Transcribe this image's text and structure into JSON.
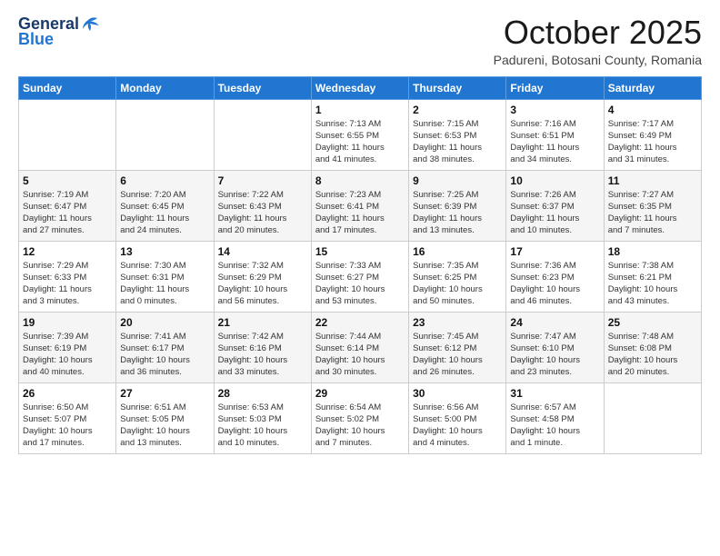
{
  "header": {
    "logo_line1": "General",
    "logo_line2": "Blue",
    "month": "October 2025",
    "location": "Padureni, Botosani County, Romania"
  },
  "weekdays": [
    "Sunday",
    "Monday",
    "Tuesday",
    "Wednesday",
    "Thursday",
    "Friday",
    "Saturday"
  ],
  "weeks": [
    [
      {
        "day": "",
        "info": ""
      },
      {
        "day": "",
        "info": ""
      },
      {
        "day": "",
        "info": ""
      },
      {
        "day": "1",
        "info": "Sunrise: 7:13 AM\nSunset: 6:55 PM\nDaylight: 11 hours\nand 41 minutes."
      },
      {
        "day": "2",
        "info": "Sunrise: 7:15 AM\nSunset: 6:53 PM\nDaylight: 11 hours\nand 38 minutes."
      },
      {
        "day": "3",
        "info": "Sunrise: 7:16 AM\nSunset: 6:51 PM\nDaylight: 11 hours\nand 34 minutes."
      },
      {
        "day": "4",
        "info": "Sunrise: 7:17 AM\nSunset: 6:49 PM\nDaylight: 11 hours\nand 31 minutes."
      }
    ],
    [
      {
        "day": "5",
        "info": "Sunrise: 7:19 AM\nSunset: 6:47 PM\nDaylight: 11 hours\nand 27 minutes."
      },
      {
        "day": "6",
        "info": "Sunrise: 7:20 AM\nSunset: 6:45 PM\nDaylight: 11 hours\nand 24 minutes."
      },
      {
        "day": "7",
        "info": "Sunrise: 7:22 AM\nSunset: 6:43 PM\nDaylight: 11 hours\nand 20 minutes."
      },
      {
        "day": "8",
        "info": "Sunrise: 7:23 AM\nSunset: 6:41 PM\nDaylight: 11 hours\nand 17 minutes."
      },
      {
        "day": "9",
        "info": "Sunrise: 7:25 AM\nSunset: 6:39 PM\nDaylight: 11 hours\nand 13 minutes."
      },
      {
        "day": "10",
        "info": "Sunrise: 7:26 AM\nSunset: 6:37 PM\nDaylight: 11 hours\nand 10 minutes."
      },
      {
        "day": "11",
        "info": "Sunrise: 7:27 AM\nSunset: 6:35 PM\nDaylight: 11 hours\nand 7 minutes."
      }
    ],
    [
      {
        "day": "12",
        "info": "Sunrise: 7:29 AM\nSunset: 6:33 PM\nDaylight: 11 hours\nand 3 minutes."
      },
      {
        "day": "13",
        "info": "Sunrise: 7:30 AM\nSunset: 6:31 PM\nDaylight: 11 hours\nand 0 minutes."
      },
      {
        "day": "14",
        "info": "Sunrise: 7:32 AM\nSunset: 6:29 PM\nDaylight: 10 hours\nand 56 minutes."
      },
      {
        "day": "15",
        "info": "Sunrise: 7:33 AM\nSunset: 6:27 PM\nDaylight: 10 hours\nand 53 minutes."
      },
      {
        "day": "16",
        "info": "Sunrise: 7:35 AM\nSunset: 6:25 PM\nDaylight: 10 hours\nand 50 minutes."
      },
      {
        "day": "17",
        "info": "Sunrise: 7:36 AM\nSunset: 6:23 PM\nDaylight: 10 hours\nand 46 minutes."
      },
      {
        "day": "18",
        "info": "Sunrise: 7:38 AM\nSunset: 6:21 PM\nDaylight: 10 hours\nand 43 minutes."
      }
    ],
    [
      {
        "day": "19",
        "info": "Sunrise: 7:39 AM\nSunset: 6:19 PM\nDaylight: 10 hours\nand 40 minutes."
      },
      {
        "day": "20",
        "info": "Sunrise: 7:41 AM\nSunset: 6:17 PM\nDaylight: 10 hours\nand 36 minutes."
      },
      {
        "day": "21",
        "info": "Sunrise: 7:42 AM\nSunset: 6:16 PM\nDaylight: 10 hours\nand 33 minutes."
      },
      {
        "day": "22",
        "info": "Sunrise: 7:44 AM\nSunset: 6:14 PM\nDaylight: 10 hours\nand 30 minutes."
      },
      {
        "day": "23",
        "info": "Sunrise: 7:45 AM\nSunset: 6:12 PM\nDaylight: 10 hours\nand 26 minutes."
      },
      {
        "day": "24",
        "info": "Sunrise: 7:47 AM\nSunset: 6:10 PM\nDaylight: 10 hours\nand 23 minutes."
      },
      {
        "day": "25",
        "info": "Sunrise: 7:48 AM\nSunset: 6:08 PM\nDaylight: 10 hours\nand 20 minutes."
      }
    ],
    [
      {
        "day": "26",
        "info": "Sunrise: 6:50 AM\nSunset: 5:07 PM\nDaylight: 10 hours\nand 17 minutes."
      },
      {
        "day": "27",
        "info": "Sunrise: 6:51 AM\nSunset: 5:05 PM\nDaylight: 10 hours\nand 13 minutes."
      },
      {
        "day": "28",
        "info": "Sunrise: 6:53 AM\nSunset: 5:03 PM\nDaylight: 10 hours\nand 10 minutes."
      },
      {
        "day": "29",
        "info": "Sunrise: 6:54 AM\nSunset: 5:02 PM\nDaylight: 10 hours\nand 7 minutes."
      },
      {
        "day": "30",
        "info": "Sunrise: 6:56 AM\nSunset: 5:00 PM\nDaylight: 10 hours\nand 4 minutes."
      },
      {
        "day": "31",
        "info": "Sunrise: 6:57 AM\nSunset: 4:58 PM\nDaylight: 10 hours\nand 1 minute."
      },
      {
        "day": "",
        "info": ""
      }
    ]
  ]
}
